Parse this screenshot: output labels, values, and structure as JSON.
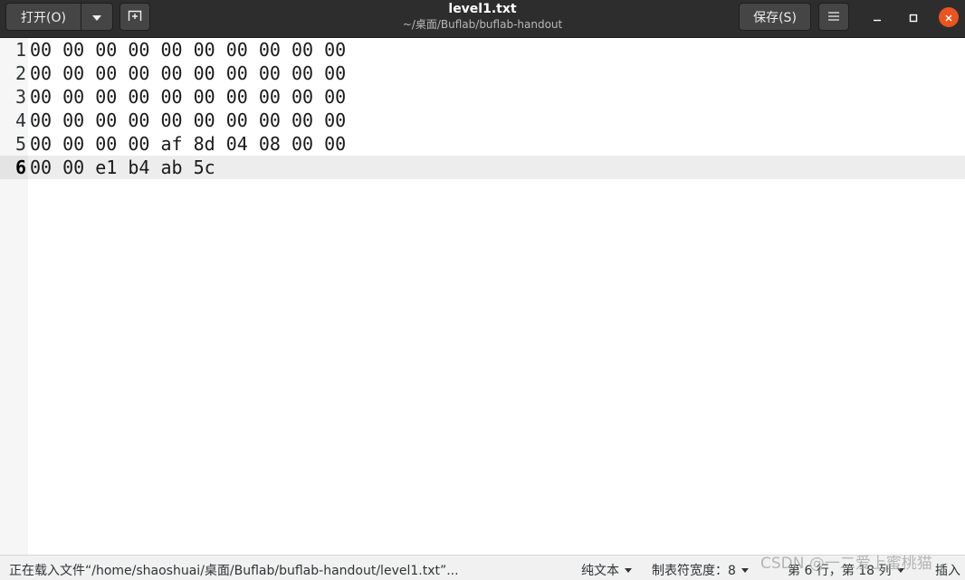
{
  "header": {
    "open_label": "打开(O)",
    "save_label": "保存(S)",
    "title": "level1.txt",
    "subtitle": "~/桌面/Buflab/buflab-handout"
  },
  "editor": {
    "lines": [
      {
        "number": "1",
        "text": "00 00 00 00 00 00 00 00 00 00"
      },
      {
        "number": "2",
        "text": "00 00 00 00 00 00 00 00 00 00"
      },
      {
        "number": "3",
        "text": "00 00 00 00 00 00 00 00 00 00"
      },
      {
        "number": "4",
        "text": "00 00 00 00 00 00 00 00 00 00"
      },
      {
        "number": "5",
        "text": "00 00 00 00 af 8d 04 08 00 00"
      },
      {
        "number": "6",
        "text": "00 00 e1 b4 ab 5c"
      }
    ],
    "current_line": 6
  },
  "statusbar": {
    "message": "正在载入文件“/home/shaoshuai/桌面/Buflab/buflab-handout/level1.txt”...",
    "file_type": "纯文本",
    "tab_width": "制表符宽度：8",
    "position": "第 6 行，第 18 列",
    "insert_mode": "插入"
  },
  "watermark": "CSDN @一二爱上蜜桃猫",
  "colors": {
    "header_bg": "#2d2d2d",
    "close_button": "#e95420",
    "current_line": "#ededed",
    "gutter": "#f6f6f6"
  }
}
